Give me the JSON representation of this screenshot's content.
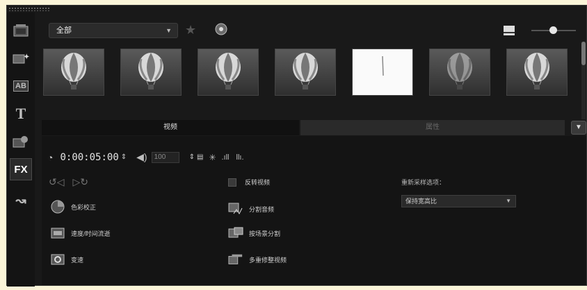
{
  "sidebar": {
    "items": [
      {
        "name": "media",
        "glyph": "▦"
      },
      {
        "name": "instant-project",
        "glyph": "✦"
      },
      {
        "name": "transition",
        "glyph": "AB"
      },
      {
        "name": "title",
        "glyph": "T"
      },
      {
        "name": "graphics",
        "glyph": "✿"
      },
      {
        "name": "filter",
        "glyph": "FX"
      },
      {
        "name": "path",
        "glyph": "↝"
      }
    ]
  },
  "library": {
    "category": "全部",
    "thumbnails": [
      {
        "label": "",
        "kind": "balloon"
      },
      {
        "label": "",
        "kind": "balloon"
      },
      {
        "label": "",
        "kind": "balloon"
      },
      {
        "label": "",
        "kind": "balloon"
      },
      {
        "label": "",
        "kind": "white"
      },
      {
        "label": "",
        "kind": "blur"
      },
      {
        "label": "",
        "kind": "balloon"
      }
    ]
  },
  "tabs": {
    "video": "视频",
    "attributes": "属性"
  },
  "options": {
    "duration": "0:00:05:00",
    "volume": "100",
    "reverse_video": "反转视频",
    "color_correction": "色彩校正",
    "split_audio": "分割音频",
    "speed_time_lapse": "速度/时间流逝",
    "split_by_scene": "按场景分割",
    "variable_speed": "变速",
    "multi_trim_video": "多重修整视频",
    "resample_label": "重新采样选项：",
    "resample_value": "保持宽高比"
  }
}
